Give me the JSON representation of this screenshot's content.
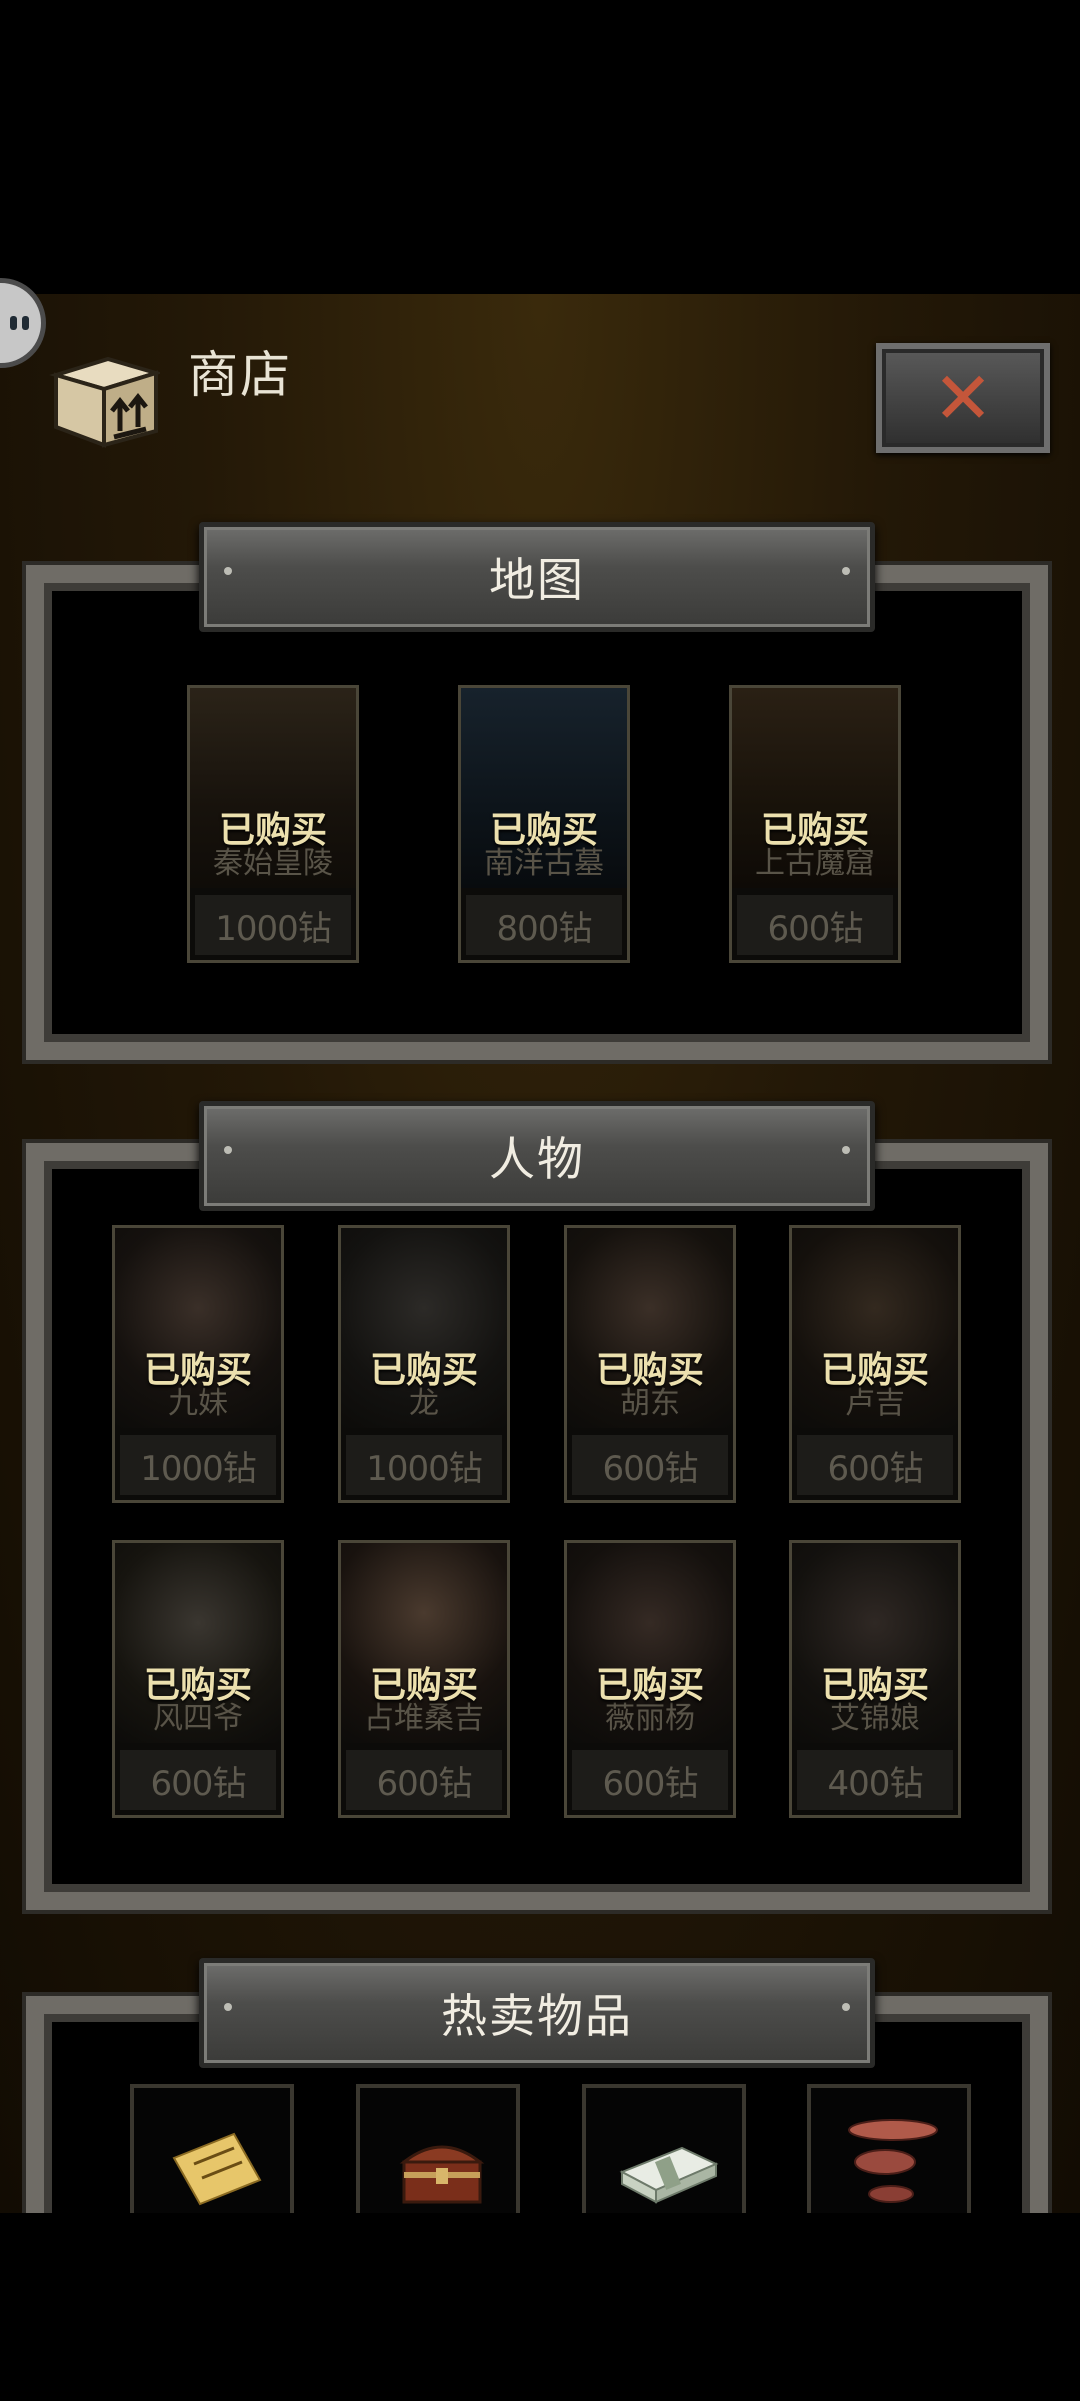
{
  "header": {
    "title": "商店",
    "close_icon": "close-icon",
    "shop_icon": "box-icon"
  },
  "sections": {
    "maps": {
      "title": "地图",
      "items": [
        {
          "name": "秦始皇陵",
          "price": "1000钻",
          "status": "已购买"
        },
        {
          "name": "南洋古墓",
          "price": "800钻",
          "status": "已购买"
        },
        {
          "name": "上古魔窟",
          "price": "600钻",
          "status": "已购买"
        }
      ]
    },
    "characters": {
      "title": "人物",
      "items": [
        {
          "name": "九妹",
          "price": "1000钻",
          "status": "已购买"
        },
        {
          "name": "龙",
          "price": "1000钻",
          "status": "已购买"
        },
        {
          "name": "胡东",
          "price": "600钻",
          "status": "已购买"
        },
        {
          "name": "卢吉",
          "price": "600钻",
          "status": "已购买"
        },
        {
          "name": "风四爷",
          "price": "600钻",
          "status": "已购买"
        },
        {
          "name": "占堆桑吉",
          "price": "600钻",
          "status": "已购买"
        },
        {
          "name": "薇丽杨",
          "price": "600钻",
          "status": "已购买"
        },
        {
          "name": "艾锦娘",
          "price": "400钻",
          "status": "已购买"
        }
      ]
    },
    "hot_items": {
      "title": "热卖物品",
      "items": [
        {
          "icon": "ticket-icon"
        },
        {
          "icon": "treasure-chest-icon"
        },
        {
          "icon": "cash-stack-icon"
        },
        {
          "icon": "fishing-lure-icon"
        }
      ]
    }
  },
  "colors": {
    "accent": "#ece0ae",
    "close_x": "#c4563a",
    "frame": "#6f6c66"
  }
}
